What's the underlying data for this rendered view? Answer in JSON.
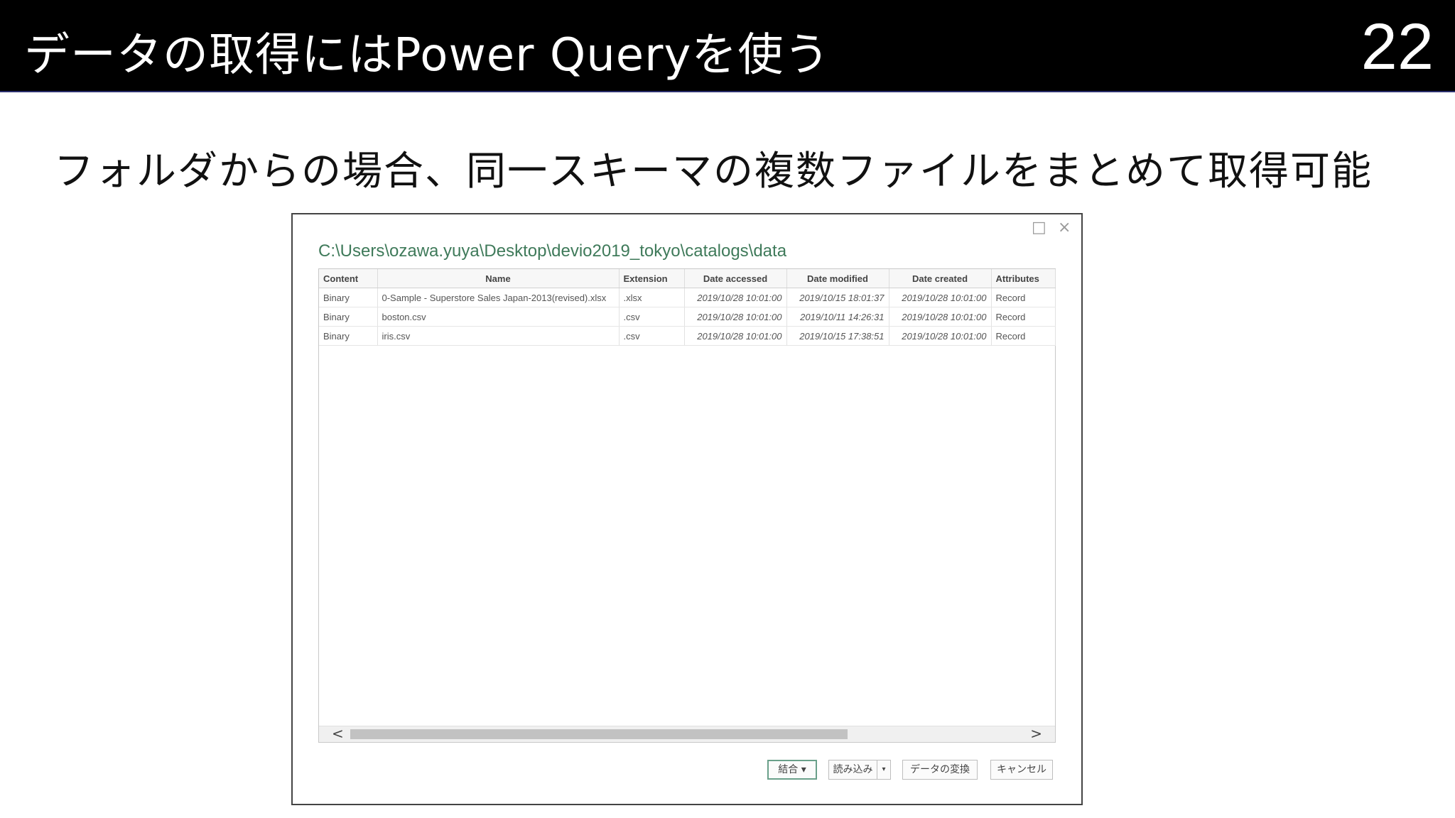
{
  "slide": {
    "title": "データの取得にはPower Queryを使う",
    "number": "22",
    "subtitle": "フォルダからの場合、同一スキーマの複数ファイルをまとめて取得可能"
  },
  "dialog": {
    "max_icon": "□",
    "close_icon": "×",
    "path": "C:\\Users\\ozawa.yuya\\Desktop\\devio2019_tokyo\\catalogs\\data",
    "columns": [
      "Content",
      "Name",
      "Extension",
      "Date accessed",
      "Date modified",
      "Date created",
      "Attributes"
    ],
    "rows": [
      [
        "Binary",
        "0-Sample - Superstore Sales Japan-2013(revised).xlsx",
        ".xlsx",
        "2019/10/28 10:01:00",
        "2019/10/15 18:01:37",
        "2019/10/28 10:01:00",
        "Record"
      ],
      [
        "Binary",
        "boston.csv",
        ".csv",
        "2019/10/28 10:01:00",
        "2019/10/11 14:26:31",
        "2019/10/28 10:01:00",
        "Record"
      ],
      [
        "Binary",
        "iris.csv",
        ".csv",
        "2019/10/28 10:01:00",
        "2019/10/15 17:38:51",
        "2019/10/28 10:01:00",
        "Record"
      ]
    ],
    "scroll_left": "<",
    "scroll_right": ">",
    "buttons": {
      "combine": "結合 ▾",
      "load": "読み込み",
      "load_arrow": "▾",
      "transform": "データの変換",
      "cancel": "キャンセル"
    }
  }
}
